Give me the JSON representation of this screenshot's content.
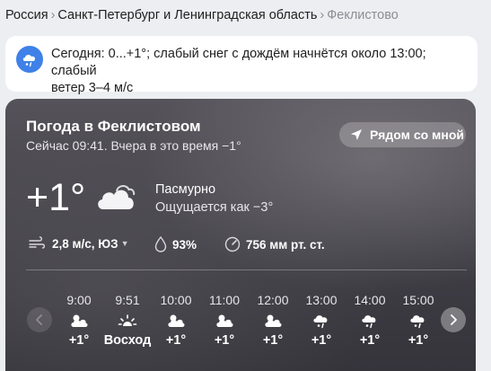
{
  "breadcrumb": {
    "country": "Россия",
    "region": "Санкт-Петербург и Ленинградская область",
    "current": "Феклистово"
  },
  "alert": {
    "icon": "snow-rain-icon",
    "line1": "Сегодня: 0...+1°; слабый снег с дождём начнётся около 13:00; слабый",
    "line2": "ветер 3–4 м/с"
  },
  "weather": {
    "title": "Погода в Феклистовом",
    "subtitle": "Сейчас 09:41. Вчера в это время −1°",
    "near_button": "Рядом со мной",
    "temperature": "+1°",
    "condition": "Пасмурно",
    "feels_like": "Ощущается как −3°",
    "wind": "2,8 м/с, ЮЗ",
    "humidity": "93%",
    "pressure": "756 мм рт. ст."
  },
  "hourly": [
    {
      "time": "9:00",
      "icon": "cloudy-day-icon",
      "value": "+1°"
    },
    {
      "time": "9:51",
      "icon": "sunrise-icon",
      "value": "Восход"
    },
    {
      "time": "10:00",
      "icon": "cloudy-day-icon",
      "value": "+1°"
    },
    {
      "time": "11:00",
      "icon": "cloudy-day-icon",
      "value": "+1°"
    },
    {
      "time": "12:00",
      "icon": "cloudy-day-icon",
      "value": "+1°"
    },
    {
      "time": "13:00",
      "icon": "snow-rain-icon",
      "value": "+1°"
    },
    {
      "time": "14:00",
      "icon": "snow-rain-icon",
      "value": "+1°"
    },
    {
      "time": "15:00",
      "icon": "snow-rain-icon",
      "value": "+1°"
    }
  ]
}
